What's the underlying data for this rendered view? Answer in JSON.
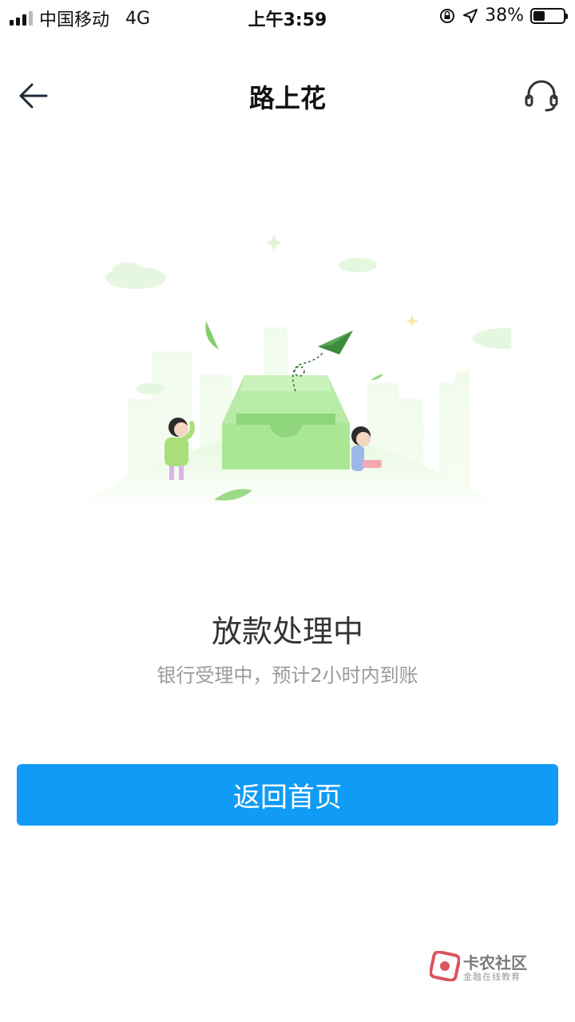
{
  "status_bar": {
    "carrier": "中国移动",
    "network": "4G",
    "time": "上午3:59",
    "battery_percent": "38%",
    "battery_level": 0.38
  },
  "nav": {
    "title": "路上花",
    "back_icon": "back-arrow-icon",
    "service_icon": "headset-icon"
  },
  "status": {
    "title": "放款处理中",
    "subtitle": "银行受理中，预计2小时内到账"
  },
  "actions": {
    "home_label": "返回首页"
  },
  "colors": {
    "accent": "#0f9bf6",
    "illustration_green": "#9ee08a"
  },
  "watermark": {
    "name": "卡农社区",
    "subtitle": "金融在线教育"
  }
}
